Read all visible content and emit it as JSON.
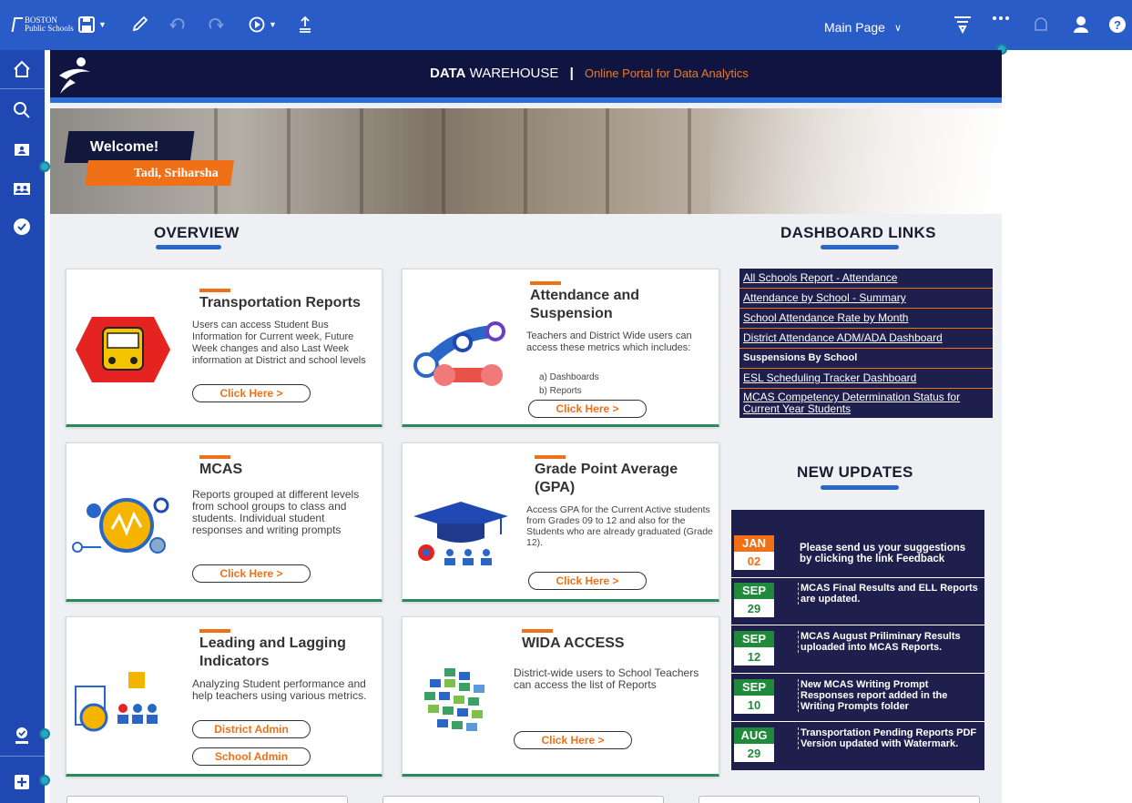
{
  "app": {
    "logo_line1": "BOSTON",
    "logo_line2": "Public Schools",
    "page_selector": "Main Page"
  },
  "toolbar": {
    "icons": [
      "save-icon",
      "pencil-icon",
      "undo-icon",
      "redo-icon",
      "play-icon",
      "share-icon"
    ],
    "right_icons": [
      "filter-icon",
      "more-icon",
      "bell-icon",
      "user-icon",
      "help-icon"
    ],
    "accent_color": "#2a5cc8"
  },
  "rail": {
    "icons": [
      "home-icon",
      "search-icon",
      "contact-card-icon",
      "group-icon",
      "check-circle-icon",
      "user-check-icon",
      "add-icon"
    ]
  },
  "header": {
    "title_bold": "DATA",
    "title_rest": "WAREHOUSE",
    "separator": "|",
    "tagline": "Online Portal for Data Analytics"
  },
  "banner": {
    "welcome": "Welcome!",
    "username": "Tadi, Sriharsha"
  },
  "overview": {
    "title": "OVERVIEW",
    "cards": [
      {
        "title": "Transportation Reports",
        "desc": "Users can access Student Bus Information for Current week, Future Week changes and also Last Week information at District and school levels",
        "button": "Click Here >"
      },
      {
        "title": "Attendance and Suspension",
        "desc": "Teachers and District Wide users can access these metrics which includes:",
        "items": [
          "a) Dashboards",
          "b) Reports"
        ],
        "button": "Click Here >"
      },
      {
        "title": "MCAS",
        "desc": "Reports grouped at different levels from school groups to class and students. Individual student responses and writing prompts",
        "button": "Click Here >"
      },
      {
        "title": "Grade Point Average (GPA)",
        "desc": "Access GPA for the Current Active students from Grades 09 to 12 and also for the Students who are already graduated (Grade 12).",
        "button": "Click Here >"
      },
      {
        "title": "Leading and Lagging Indicators",
        "desc": "Analyzing Student performance and help teachers using various metrics.",
        "button": "District Admin",
        "button2": "School Admin"
      },
      {
        "title": "WIDA ACCESS",
        "desc": "District-wide users to School Teachers can access the list of Reports",
        "button": "Click Here >"
      }
    ]
  },
  "dashboard_links": {
    "title": "DASHBOARD LINKS",
    "links": [
      "All Schools Report - Attendance",
      "Attendance by School - Summary",
      "School Attendance Rate by Month",
      "District Attendance ADM/ADA Dashboard",
      "Suspensions By School",
      "ESL Scheduling Tracker Dashboard",
      "MCAS Competency Determination Status for Current Year Students"
    ]
  },
  "new_updates": {
    "title": "NEW UPDATES",
    "items": [
      {
        "month": "JAN",
        "day": "02",
        "text": "Please send us your suggestions by clicking the link  Feedback",
        "color": "#f07018"
      },
      {
        "month": "SEP",
        "day": "29",
        "text": "MCAS Final Results and ELL Reports are updated.",
        "color": "#1f8a3a"
      },
      {
        "month": "SEP",
        "day": "12",
        "text": "MCAS August Priliminary Results uploaded into MCAS Reports.",
        "color": "#1f8a3a"
      },
      {
        "month": "SEP",
        "day": "10",
        "text": "New MCAS Writing Prompt Responses report added in the Writing Prompts folder",
        "color": "#1f8a3a"
      },
      {
        "month": "AUG",
        "day": "29",
        "text": "Transportation Pending Reports PDF Version updated with Watermark.",
        "color": "#1f8a3a"
      }
    ]
  }
}
